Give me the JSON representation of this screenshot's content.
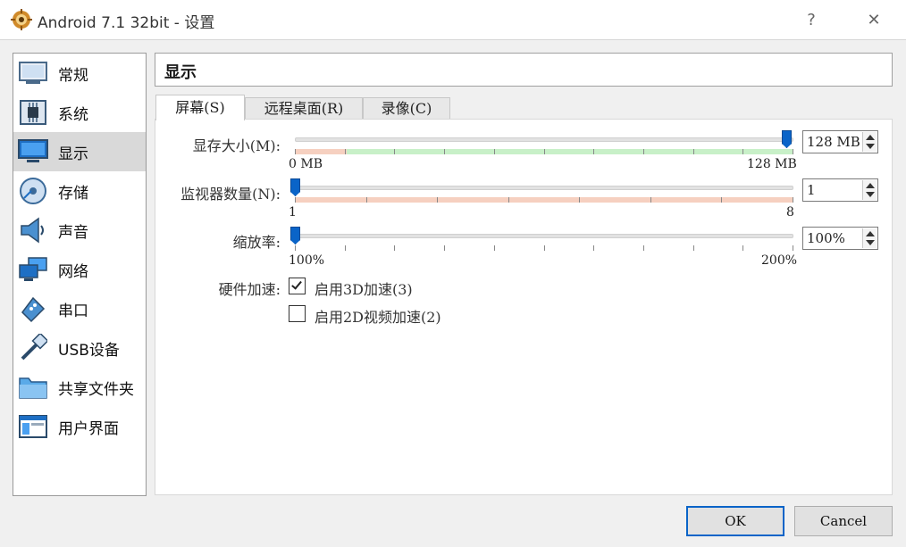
{
  "window": {
    "title": "Android 7.1 32bit - 设置",
    "help_label": "?",
    "close_label": "✕"
  },
  "sidebar": {
    "items": [
      {
        "label": "常规",
        "icon": "general-icon"
      },
      {
        "label": "系统",
        "icon": "system-chip-icon"
      },
      {
        "label": "显示",
        "icon": "display-monitor-icon",
        "selected": true
      },
      {
        "label": "存储",
        "icon": "storage-disk-icon"
      },
      {
        "label": "声音",
        "icon": "audio-speaker-icon"
      },
      {
        "label": "网络",
        "icon": "network-icon"
      },
      {
        "label": "串口",
        "icon": "serial-port-icon"
      },
      {
        "label": "USB设备",
        "icon": "usb-icon"
      },
      {
        "label": "共享文件夹",
        "icon": "shared-folder-icon"
      },
      {
        "label": "用户界面",
        "icon": "user-interface-icon"
      }
    ]
  },
  "section_title": "显示",
  "tabs": [
    {
      "label": "屏幕(S)",
      "active": true
    },
    {
      "label": "远程桌面(R)"
    },
    {
      "label": "录像(C)"
    }
  ],
  "screen": {
    "video_memory": {
      "label": "显存大小(M):",
      "min_label": "0 MB",
      "max_label": "128 MB",
      "value": "128 MB",
      "level": 1.0
    },
    "monitor_count": {
      "label": "监视器数量(N):",
      "min_label": "1",
      "max_label": "8",
      "value": "1",
      "level": 0.0
    },
    "scale_factor": {
      "label": "缩放率:",
      "min_label": "100%",
      "max_label": "200%",
      "value": "100%",
      "level": 0.0
    },
    "acceleration": {
      "label": "硬件加速:",
      "enable_3d": {
        "label": "启用3D加速(3)",
        "checked": true
      },
      "enable_2d": {
        "label": "启用2D视频加速(2)",
        "checked": false
      }
    }
  },
  "buttons": {
    "ok": "OK",
    "cancel": "Cancel"
  },
  "colors": {
    "accent": "#0a64c8",
    "band_ok": "#c8f0c8",
    "band_warn": "#f6d0c0",
    "selected_item": "#d9d9d9"
  }
}
